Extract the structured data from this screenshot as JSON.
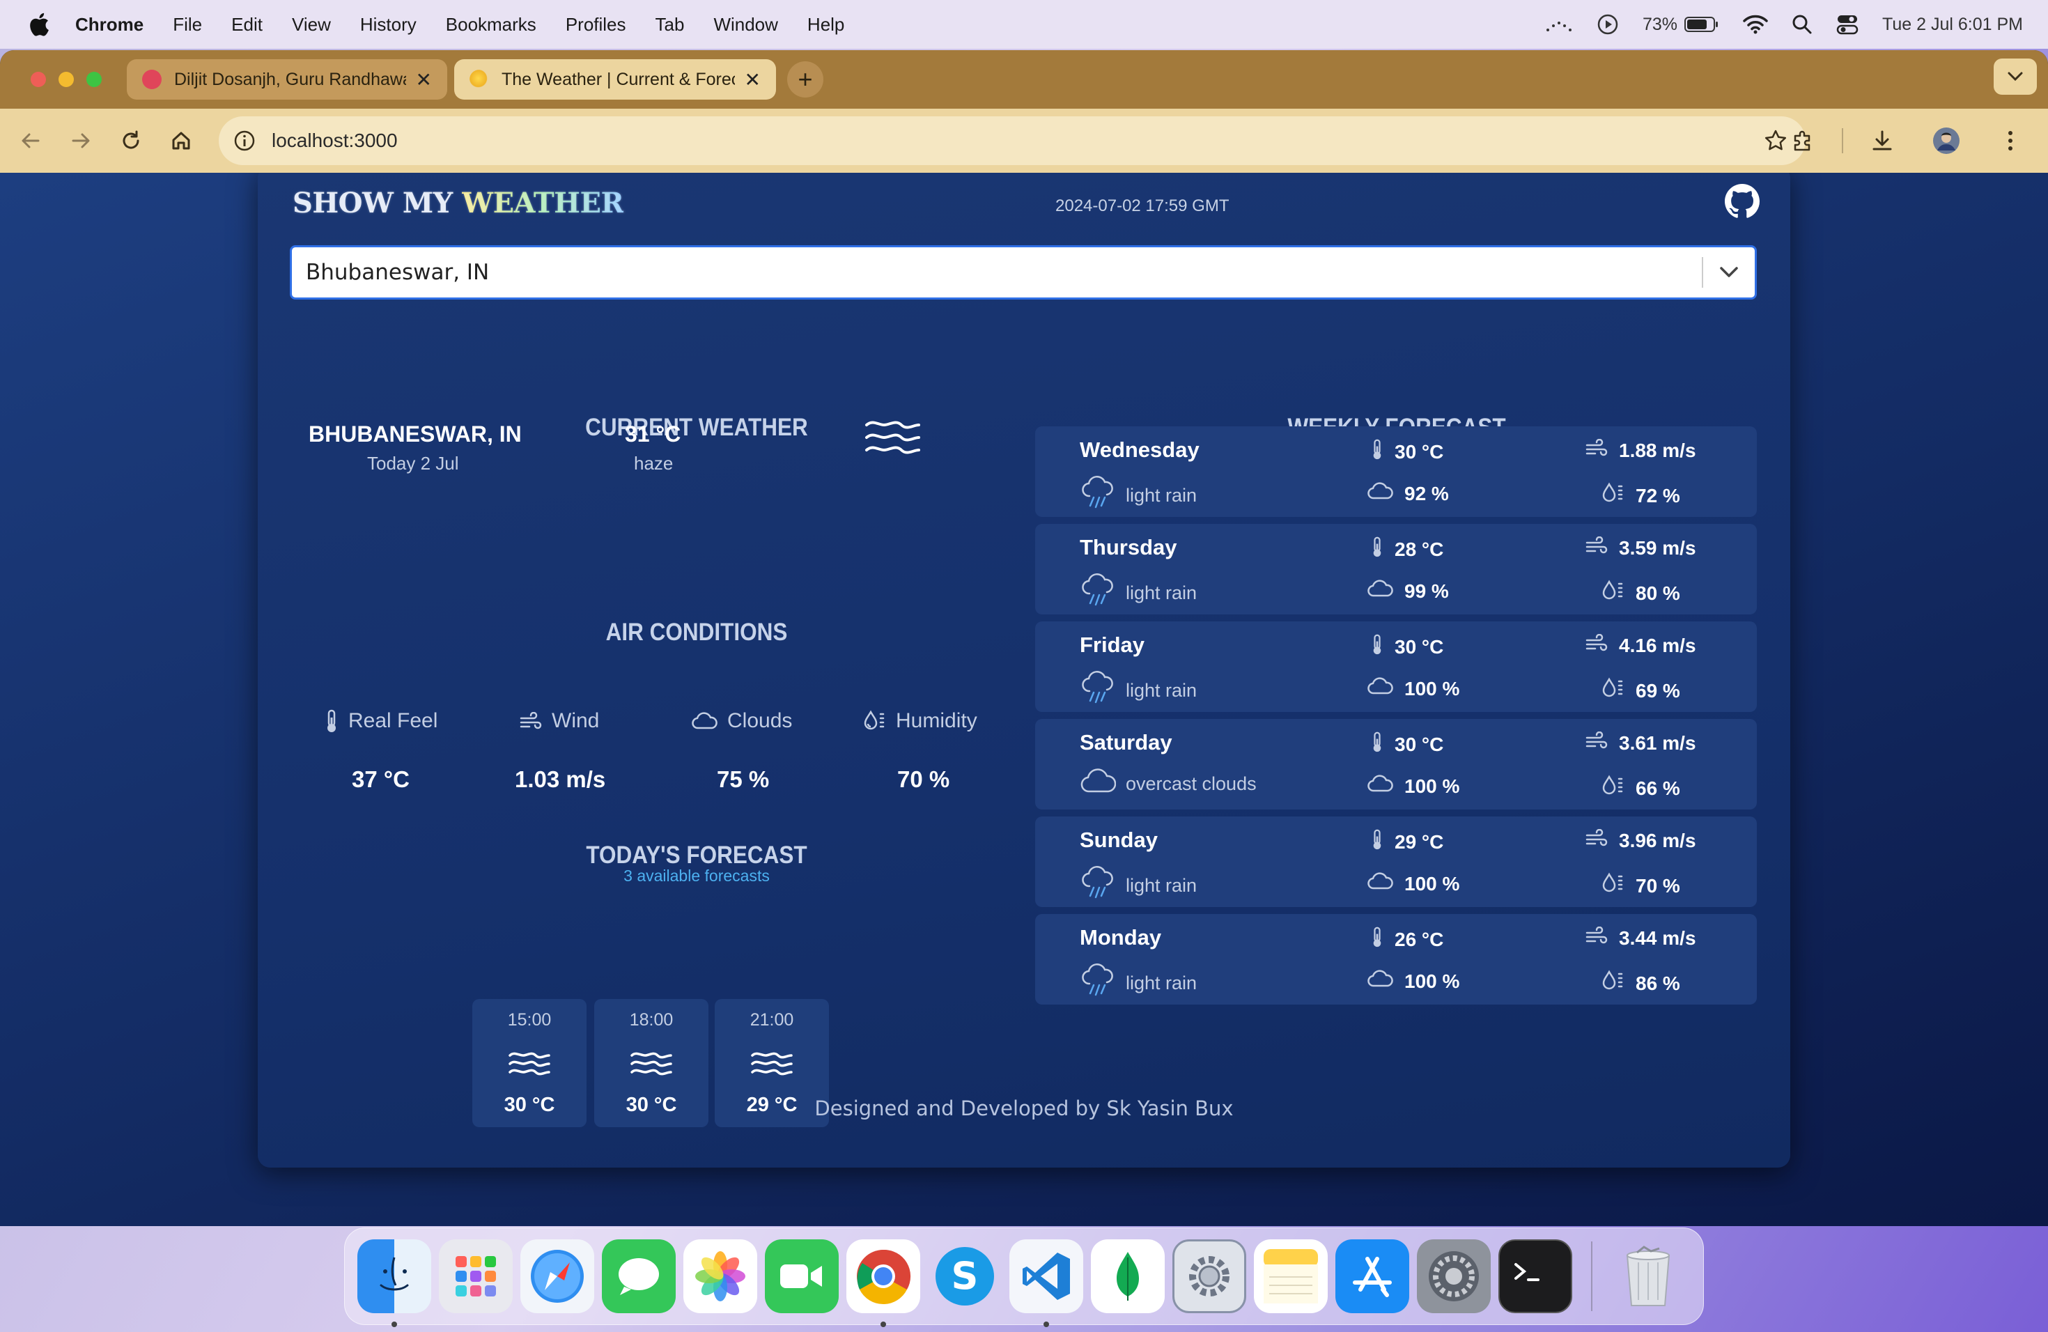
{
  "menubar": {
    "app_name": "Chrome",
    "items": [
      "File",
      "Edit",
      "View",
      "History",
      "Bookmarks",
      "Profiles",
      "Tab",
      "Window",
      "Help"
    ],
    "battery": "73%",
    "datetime": "Tue 2 Jul  6:01 PM"
  },
  "browser": {
    "tabs": [
      {
        "title": "Diljit Dosanjh, Guru Randhawa",
        "active": false
      },
      {
        "title": "The Weather | Current & Forecast",
        "active": true
      }
    ],
    "url": "localhost:3000"
  },
  "app": {
    "brand_pre": "SHOW MY ",
    "brand_accent": "WEATHER",
    "timestamp": "2024-07-02 17:59 GMT",
    "search_value": "Bhubaneswar, IN",
    "current": {
      "title": "CURRENT WEATHER",
      "city": "BHUBANESWAR, IN",
      "date": "Today 2 Jul",
      "temp": "31 °C",
      "desc": "haze",
      "icon": "haze-icon"
    },
    "air": {
      "title": "AIR CONDITIONS",
      "items": [
        {
          "label": "Real Feel",
          "value": "37 °C",
          "icon": "thermometer-icon"
        },
        {
          "label": "Wind",
          "value": "1.03 m/s",
          "icon": "wind-icon"
        },
        {
          "label": "Clouds",
          "value": "75 %",
          "icon": "cloud-icon"
        },
        {
          "label": "Humidity",
          "value": "70 %",
          "icon": "humidity-icon"
        }
      ]
    },
    "today": {
      "title": "TODAY'S FORECAST",
      "subtitle": "3 available forecasts",
      "items": [
        {
          "time": "15:00",
          "temp": "30 °C",
          "icon": "haze-icon"
        },
        {
          "time": "18:00",
          "temp": "30 °C",
          "icon": "haze-icon"
        },
        {
          "time": "21:00",
          "temp": "29 °C",
          "icon": "haze-icon"
        }
      ]
    },
    "weekly": {
      "title": "WEEKLY FORECAST",
      "items": [
        {
          "day": "Wednesday",
          "desc": "light rain",
          "temp": "30 °C",
          "clouds": "92 %",
          "wind": "1.88 m/s",
          "humidity": "72 %",
          "icon": "rain-cloud-icon"
        },
        {
          "day": "Thursday",
          "desc": "light rain",
          "temp": "28 °C",
          "clouds": "99 %",
          "wind": "3.59 m/s",
          "humidity": "80 %",
          "icon": "rain-cloud-icon"
        },
        {
          "day": "Friday",
          "desc": "light rain",
          "temp": "30 °C",
          "clouds": "100 %",
          "wind": "4.16 m/s",
          "humidity": "69 %",
          "icon": "rain-cloud-icon"
        },
        {
          "day": "Saturday",
          "desc": "overcast clouds",
          "temp": "30 °C",
          "clouds": "100 %",
          "wind": "3.61 m/s",
          "humidity": "66 %",
          "icon": "cloud-icon"
        },
        {
          "day": "Sunday",
          "desc": "light rain",
          "temp": "29 °C",
          "clouds": "100 %",
          "wind": "3.96 m/s",
          "humidity": "70 %",
          "icon": "rain-cloud-icon"
        },
        {
          "day": "Monday",
          "desc": "light rain",
          "temp": "26 °C",
          "clouds": "100 %",
          "wind": "3.44 m/s",
          "humidity": "86 %",
          "icon": "rain-cloud-icon"
        }
      ]
    },
    "footer": "Designed and Developed by Sk Yasin Bux"
  },
  "dock": [
    "finder-icon",
    "launchpad-icon",
    "safari-icon",
    "messages-icon",
    "photos-icon",
    "facetime-icon",
    "chrome-icon",
    "skype-icon",
    "vscode-icon",
    "mongodb-compass-icon",
    "system-utility-icon",
    "notes-icon",
    "app-store-icon",
    "system-settings-icon",
    "terminal-icon",
    "trash-icon"
  ],
  "colors": {
    "page_bg": "#163066",
    "accent_blue": "#2f6fe6",
    "tab_strip": "#a37a3b",
    "toolbar": "#ecd59f",
    "subtitle_blue": "#4db1f0"
  }
}
